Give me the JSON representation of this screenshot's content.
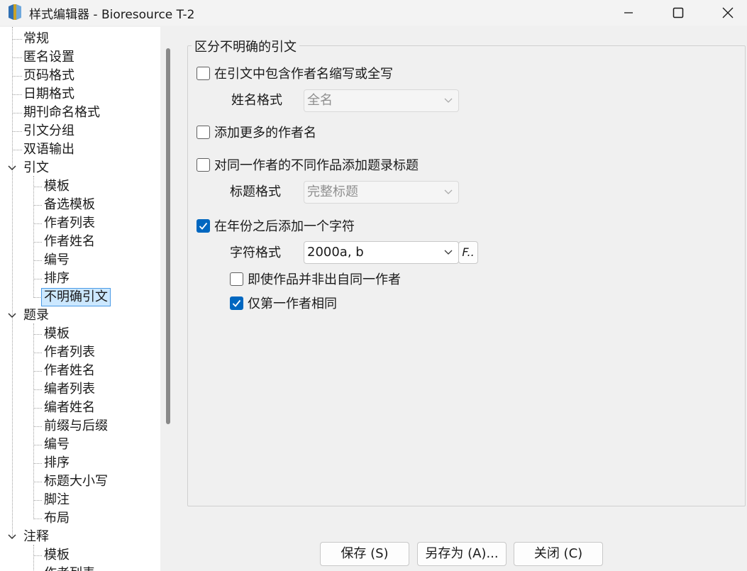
{
  "window": {
    "title": "样式编辑器 - Bioresource T-2"
  },
  "tree": {
    "items": [
      {
        "label": "常规"
      },
      {
        "label": "匿名设置"
      },
      {
        "label": "页码格式"
      },
      {
        "label": "日期格式"
      },
      {
        "label": "期刊命名格式"
      },
      {
        "label": "引文分组"
      },
      {
        "label": "双语输出"
      },
      {
        "label": "引文",
        "expanded": true
      },
      {
        "label": "模板"
      },
      {
        "label": "备选模板"
      },
      {
        "label": "作者列表"
      },
      {
        "label": "作者姓名"
      },
      {
        "label": "编号"
      },
      {
        "label": "排序"
      },
      {
        "label": "不明确引文",
        "selected": true
      },
      {
        "label": "题录",
        "expanded": true
      },
      {
        "label": "模板"
      },
      {
        "label": "作者列表"
      },
      {
        "label": "作者姓名"
      },
      {
        "label": "编者列表"
      },
      {
        "label": "编者姓名"
      },
      {
        "label": "前缀与后缀"
      },
      {
        "label": "编号"
      },
      {
        "label": "排序"
      },
      {
        "label": "标题大小写"
      },
      {
        "label": "脚注"
      },
      {
        "label": "布局"
      },
      {
        "label": "注释",
        "expanded": true
      },
      {
        "label": "模板"
      },
      {
        "label": "作者列表"
      }
    ]
  },
  "panel": {
    "group_title": "区分不明确的引文",
    "include_author_initials": {
      "label": "在引文中包含作者名缩写或全写",
      "checked": false
    },
    "name_format": {
      "label": "姓名格式",
      "value": "全名"
    },
    "add_more_authors": {
      "label": "添加更多的作者名",
      "checked": false
    },
    "add_title_for_works": {
      "label": "对同一作者的不同作品添加题录标题",
      "checked": false
    },
    "title_format": {
      "label": "标题格式",
      "value": "完整标题"
    },
    "add_char_after_year": {
      "label": "在年份之后添加一个字符",
      "checked": true
    },
    "char_format": {
      "label": "字符格式",
      "value": "2000a, b",
      "font_button": "F.."
    },
    "even_if_not_same_author": {
      "label": "即使作品并非出自同一作者",
      "checked": false
    },
    "first_author_only": {
      "label": "仅第一作者相同",
      "checked": true
    }
  },
  "buttons": {
    "save": "保存 (S)",
    "save_as": "另存为 (A)...",
    "close": "关闭 (C)"
  },
  "colors": {
    "accent": "#0067c0",
    "selection_bg": "#cce8ff"
  }
}
